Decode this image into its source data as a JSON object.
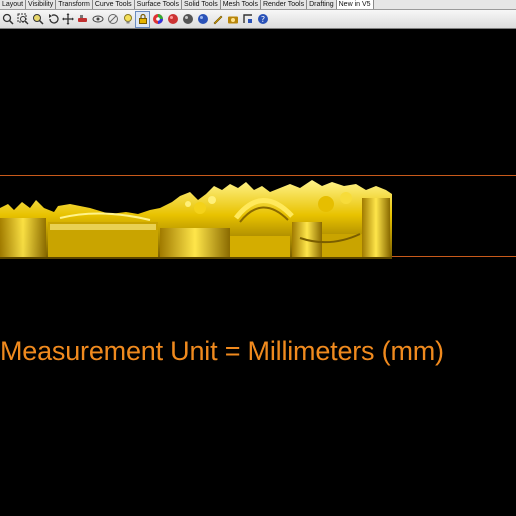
{
  "menu_tabs": [
    {
      "label": "Layout"
    },
    {
      "label": "Visibility"
    },
    {
      "label": "Transform"
    },
    {
      "label": "Curve Tools"
    },
    {
      "label": "Surface Tools"
    },
    {
      "label": "Solid Tools"
    },
    {
      "label": "Mesh Tools"
    },
    {
      "label": "Render Tools"
    },
    {
      "label": "Drafting"
    },
    {
      "label": "New in V5"
    }
  ],
  "toolbar_icons": [
    "zoom-extents-icon",
    "zoom-window-icon",
    "zoom-dynamic-icon",
    "undo-view-icon",
    "move-icon",
    "paint-icon",
    "hide-icon",
    "cancel-icon",
    "lightbulb-icon",
    "lock-icon",
    "color-wheel-icon",
    "render-sphere-icon",
    "shaded-sphere-icon",
    "blue-sphere-icon",
    "pen-icon",
    "camera-icon",
    "snap-icon",
    "help-icon"
  ],
  "viewport": {
    "annotation": "Measurement Unit = Millimeters (mm)",
    "annotation_color": "#f08a1e",
    "guide_color": "#c85a1b",
    "model_color": "#e8c200"
  }
}
